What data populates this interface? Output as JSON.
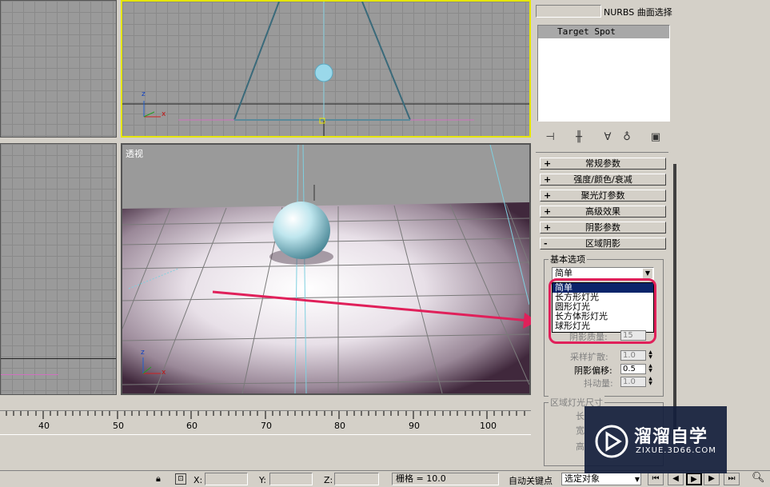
{
  "viewports": {
    "front_axes": {
      "z": "z",
      "x": "x"
    },
    "perspective": {
      "label": "透视",
      "axes": {
        "z": "z",
        "x": "x"
      }
    }
  },
  "top_panel": {
    "nurbs_label": "NURBS 曲面选择"
  },
  "object_list": {
    "items": [
      "Target Spot"
    ]
  },
  "rollouts": [
    {
      "sign": "+",
      "label": "常规参数"
    },
    {
      "sign": "+",
      "label": "强度/颜色/衰减"
    },
    {
      "sign": "+",
      "label": "聚光灯参数"
    },
    {
      "sign": "+",
      "label": "高级效果"
    },
    {
      "sign": "+",
      "label": "阴影参数"
    },
    {
      "sign": "-",
      "label": "区域阴影"
    }
  ],
  "area_shadows": {
    "group_basic": "基本选项",
    "dropdown_selected": "简单",
    "dropdown_options": [
      "简单",
      "长方形灯光",
      "圆形灯光",
      "长方体形灯光",
      "球形灯光"
    ],
    "shadow_quality_label": "阴影质量:",
    "shadow_quality_value": "15",
    "sample_spread_label": "采样扩散:",
    "sample_spread_value": "1.0",
    "shadow_bias_label": "阴影偏移:",
    "shadow_bias_value": "0.5",
    "jitter_label": "抖动量:",
    "jitter_value": "1.0",
    "group_dimensions": "区域灯光尺寸",
    "dim_length": "长",
    "dim_width": "宽",
    "dim_height": "高"
  },
  "timeline": {
    "ticks": [
      "40",
      "50",
      "60",
      "70",
      "80",
      "90",
      "100"
    ]
  },
  "status": {
    "x_label": "X:",
    "y_label": "Y:",
    "z_label": "Z:",
    "grid_text": "栅格 = 10.0",
    "auto_key": "自动关键点",
    "selected_mode": "选定对象"
  },
  "watermark": {
    "brand": "溜溜自学",
    "url": "ZIXUE.3D66.COM"
  },
  "colors": {
    "highlight": "#e0205a",
    "selection_blue": "#0a246a",
    "viewport_active": "#e6e600"
  }
}
